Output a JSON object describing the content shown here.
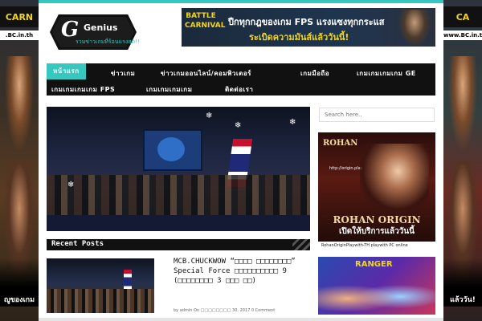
{
  "skins": {
    "left": {
      "brand": "CARN",
      "url": ".BC.in.th",
      "slogan": "ญูของเกม"
    },
    "right": {
      "brand": "CA",
      "url": "www.BC.in.th",
      "slogan": "แล้ววัน!"
    }
  },
  "logo": {
    "letter": "G",
    "text": "Genius",
    "tagline": "รวมข่าวเกมที่ร้อนแรงสุด!!"
  },
  "banner": {
    "brand": "BATTLE CARNIVAL",
    "url": "www.BC.in.th",
    "line1": "ปืกทุกกฎของเกม FPS แรงแซงทุกกระแส",
    "line2": "ระเบิดความมันส์แล้ววันนี้!"
  },
  "nav": {
    "items": [
      {
        "label": "หน้าแรก",
        "active": true
      },
      {
        "label": "ข่าวเกม",
        "active": false
      },
      {
        "label": "ข่าวเกมออนไลน์/คอมพิวเตอร์",
        "active": false
      },
      {
        "label": "เกมมือถือ",
        "active": false
      },
      {
        "label": "เกมเกมเกมเกม GE",
        "active": false
      },
      {
        "label": "เกมเกมเกมเกม FPS",
        "active": false
      },
      {
        "label": "เกมเกมเกมเกม",
        "active": false
      },
      {
        "label": "ติดต่อเรา",
        "active": false
      }
    ]
  },
  "recent": {
    "title": "Recent Posts"
  },
  "post": {
    "title": "MCB.CHUCKWOW “□□□□ □□□□□□□□” Special Force □□□□□□□□□□ 9 (□□□□□□□□ 3 □□□ □□)",
    "meta": "by admin On □□□□□□□□ 30, 2017 0 Comment"
  },
  "search": {
    "placeholder": "Search here.."
  },
  "ads": {
    "rohan": {
      "logo": "ROHAN",
      "url": "http://origin.playwith.in.th",
      "name": "ROHAN ORIGIN",
      "slogan": "เปิดให้บริการแล้ววันนี้",
      "footer": "RohanOriginPlaywith-TH   playwith   PC online"
    },
    "game": {
      "logo": "RANGER"
    }
  },
  "colors": {
    "accent": "#36c7c0",
    "nav_bg": "#111111",
    "banner_yellow": "#f2d51b"
  }
}
